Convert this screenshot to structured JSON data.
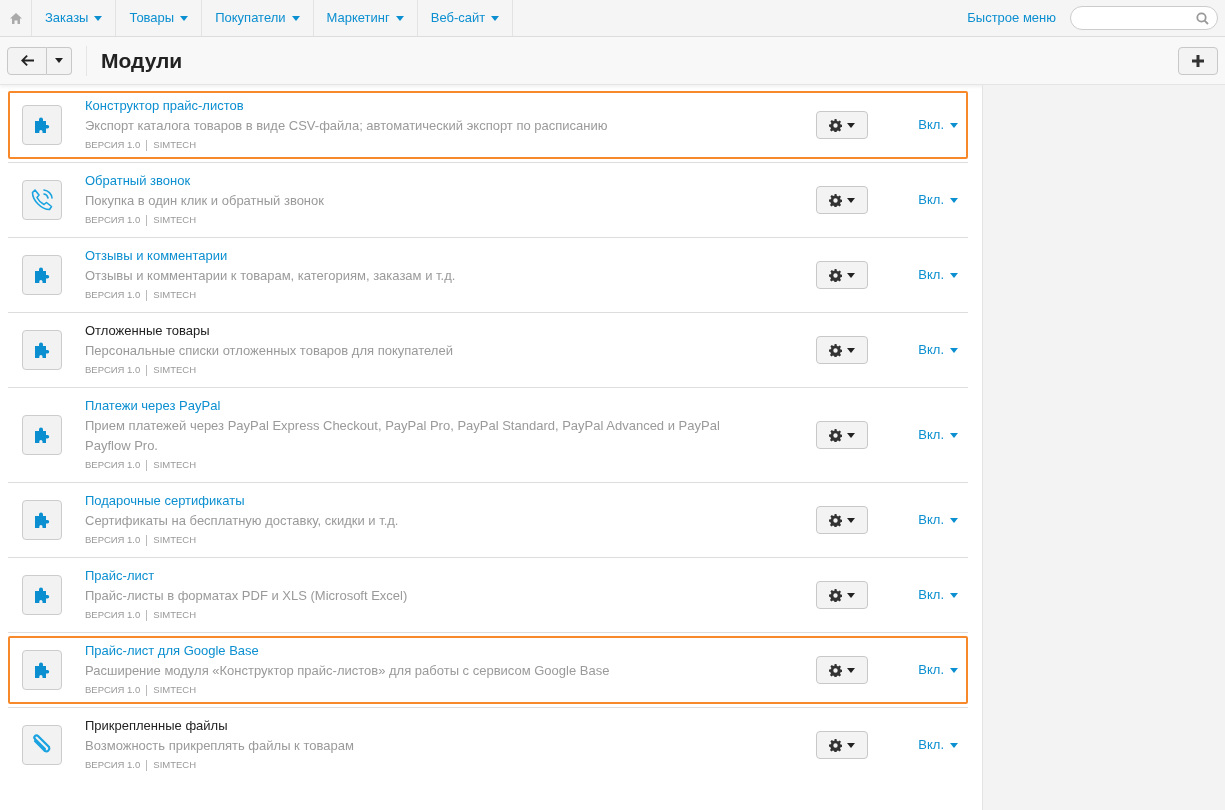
{
  "top_nav": {
    "menus": [
      {
        "label": "Заказы"
      },
      {
        "label": "Товары"
      },
      {
        "label": "Покупатели"
      },
      {
        "label": "Маркетинг"
      },
      {
        "label": "Веб-сайт"
      }
    ],
    "quick_menu": "Быстрое меню"
  },
  "toolbar": {
    "title": "Модули"
  },
  "modules": [
    {
      "kind": "puzzle",
      "title": "Конструктор прайс-листов",
      "link": true,
      "highlighted": true,
      "description": "Экспорт каталога товаров в виде CSV-файла; автоматический экспорт по расписанию",
      "version": "ВЕРСИЯ 1.0",
      "vendor": "SIMTECH",
      "status": "Вкл."
    },
    {
      "kind": "phone",
      "title": "Обратный звонок",
      "link": true,
      "highlighted": false,
      "description": "Покупка в один клик и обратный звонок",
      "version": "ВЕРСИЯ 1.0",
      "vendor": "SIMTECH",
      "status": "Вкл."
    },
    {
      "kind": "puzzle",
      "title": "Отзывы и комментарии",
      "link": true,
      "highlighted": false,
      "description": "Отзывы и комментарии к товарам, категориям, заказам и т.д.",
      "version": "ВЕРСИЯ 1.0",
      "vendor": "SIMTECH",
      "status": "Вкл."
    },
    {
      "kind": "puzzle",
      "title": "Отложенные товары",
      "link": false,
      "highlighted": false,
      "description": "Персональные списки отложенных товаров для покупателей",
      "version": "ВЕРСИЯ 1.0",
      "vendor": "SIMTECH",
      "status": "Вкл."
    },
    {
      "kind": "puzzle",
      "title": "Платежи через PayPal",
      "link": true,
      "highlighted": false,
      "description": "Прием платежей через PayPal Express Checkout, PayPal Pro, PayPal Standard, PayPal Advanced и PayPal Payflow Pro.",
      "version": "ВЕРСИЯ 1.0",
      "vendor": "SIMTECH",
      "status": "Вкл."
    },
    {
      "kind": "puzzle",
      "title": "Подарочные сертификаты",
      "link": true,
      "highlighted": false,
      "description": "Сертификаты на бесплатную доставку, скидки и т.д.",
      "version": "ВЕРСИЯ 1.0",
      "vendor": "SIMTECH",
      "status": "Вкл."
    },
    {
      "kind": "puzzle",
      "title": "Прайс-лист",
      "link": true,
      "highlighted": false,
      "description": "Прайс-листы в форматах PDF и XLS (Microsoft Excel)",
      "version": "ВЕРСИЯ 1.0",
      "vendor": "SIMTECH",
      "status": "Вкл."
    },
    {
      "kind": "puzzle",
      "title": "Прайс-лист для Google Base",
      "link": true,
      "highlighted": true,
      "description": "Расширение модуля «Конструктор прайс-листов» для работы с сервисом Google Base",
      "version": "ВЕРСИЯ 1.0",
      "vendor": "SIMTECH",
      "status": "Вкл."
    },
    {
      "kind": "clip",
      "title": "Прикрепленные файлы",
      "link": false,
      "highlighted": false,
      "description": "Возможность прикреплять файлы к товарам",
      "version": "ВЕРСИЯ 1.0",
      "vendor": "SIMTECH",
      "status": "Вкл."
    }
  ]
}
